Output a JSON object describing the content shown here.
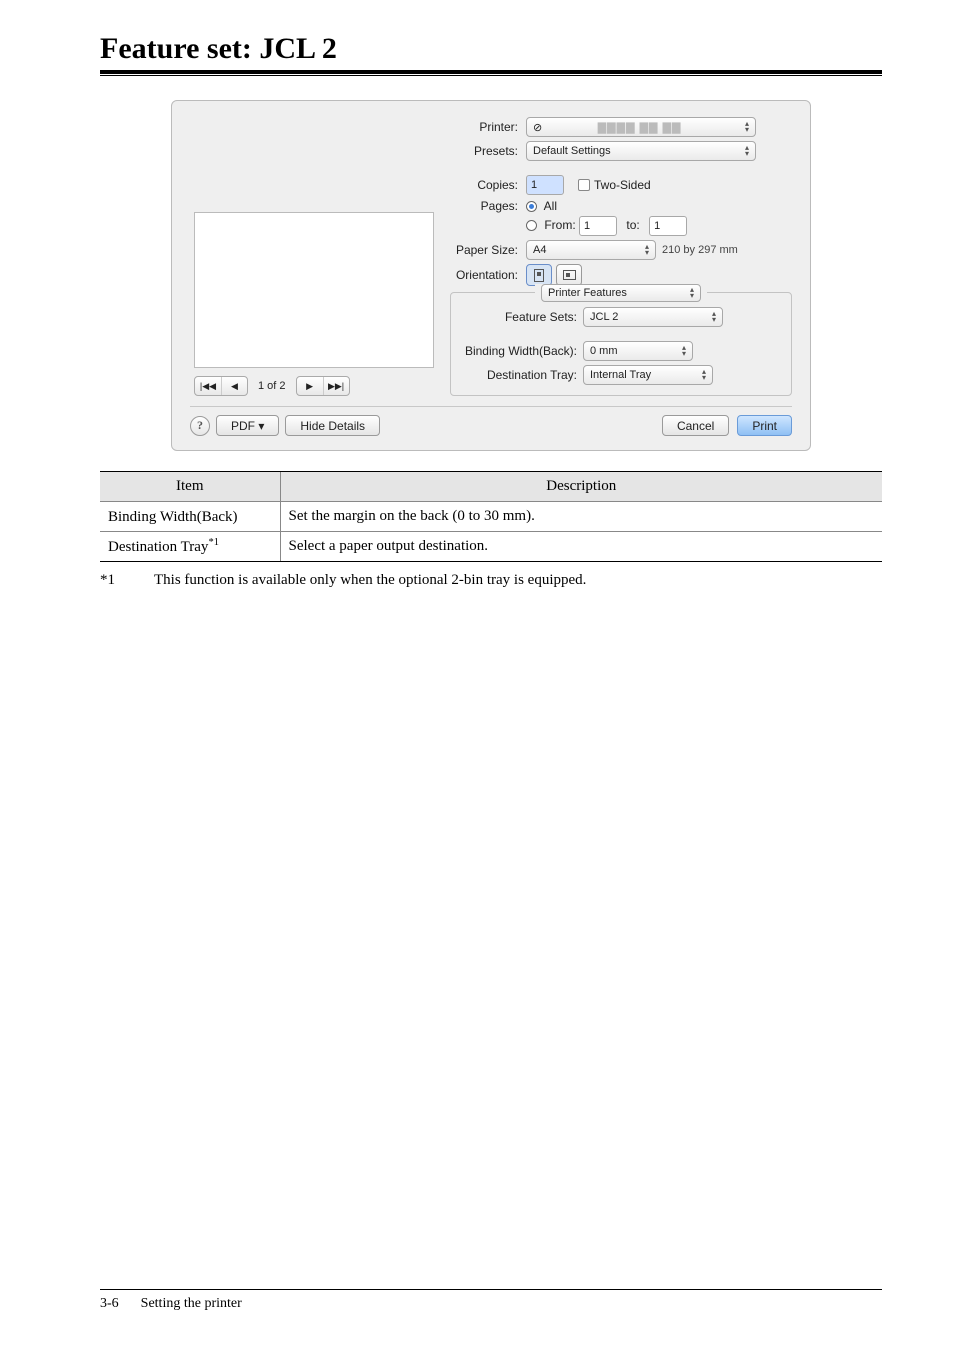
{
  "page": {
    "title": "Feature set: JCL 2",
    "footer_num": "3-6",
    "footer_text": "Setting the printer"
  },
  "dialog": {
    "labels": {
      "printer": "Printer:",
      "presets": "Presets:",
      "copies": "Copies:",
      "two_sided": "Two-Sided",
      "pages": "Pages:",
      "all": "All",
      "from": "From:",
      "to": "to:",
      "paper_size": "Paper Size:",
      "orientation": "Orientation:",
      "feature_sets": "Feature Sets:",
      "binding_width": "Binding Width(Back):",
      "destination_tray": "Destination Tray:"
    },
    "values": {
      "printer": "⊘",
      "presets": "Default Settings",
      "copies": "1",
      "from": "1",
      "to": "1",
      "paper_size": "A4",
      "paper_dim": "210 by 297 mm",
      "section": "Printer Features",
      "feature_set": "JCL 2",
      "binding_width": "0 mm",
      "destination_tray": "Internal Tray",
      "pager": "1 of 2"
    },
    "buttons": {
      "pdf": "PDF ▾",
      "hide_details": "Hide Details",
      "cancel": "Cancel",
      "print": "Print",
      "help": "?"
    }
  },
  "table": {
    "headers": {
      "item": "Item",
      "desc": "Description"
    },
    "rows": [
      {
        "item": "Binding Width(Back)",
        "item_sup": "",
        "desc": "Set the margin on the back (0 to 30 mm)."
      },
      {
        "item": "Destination Tray",
        "item_sup": "*1",
        "desc": "Select a paper output destination."
      }
    ]
  },
  "footnote": {
    "mark": "*1",
    "text": "This function is available only when the optional 2-bin tray is equipped."
  }
}
